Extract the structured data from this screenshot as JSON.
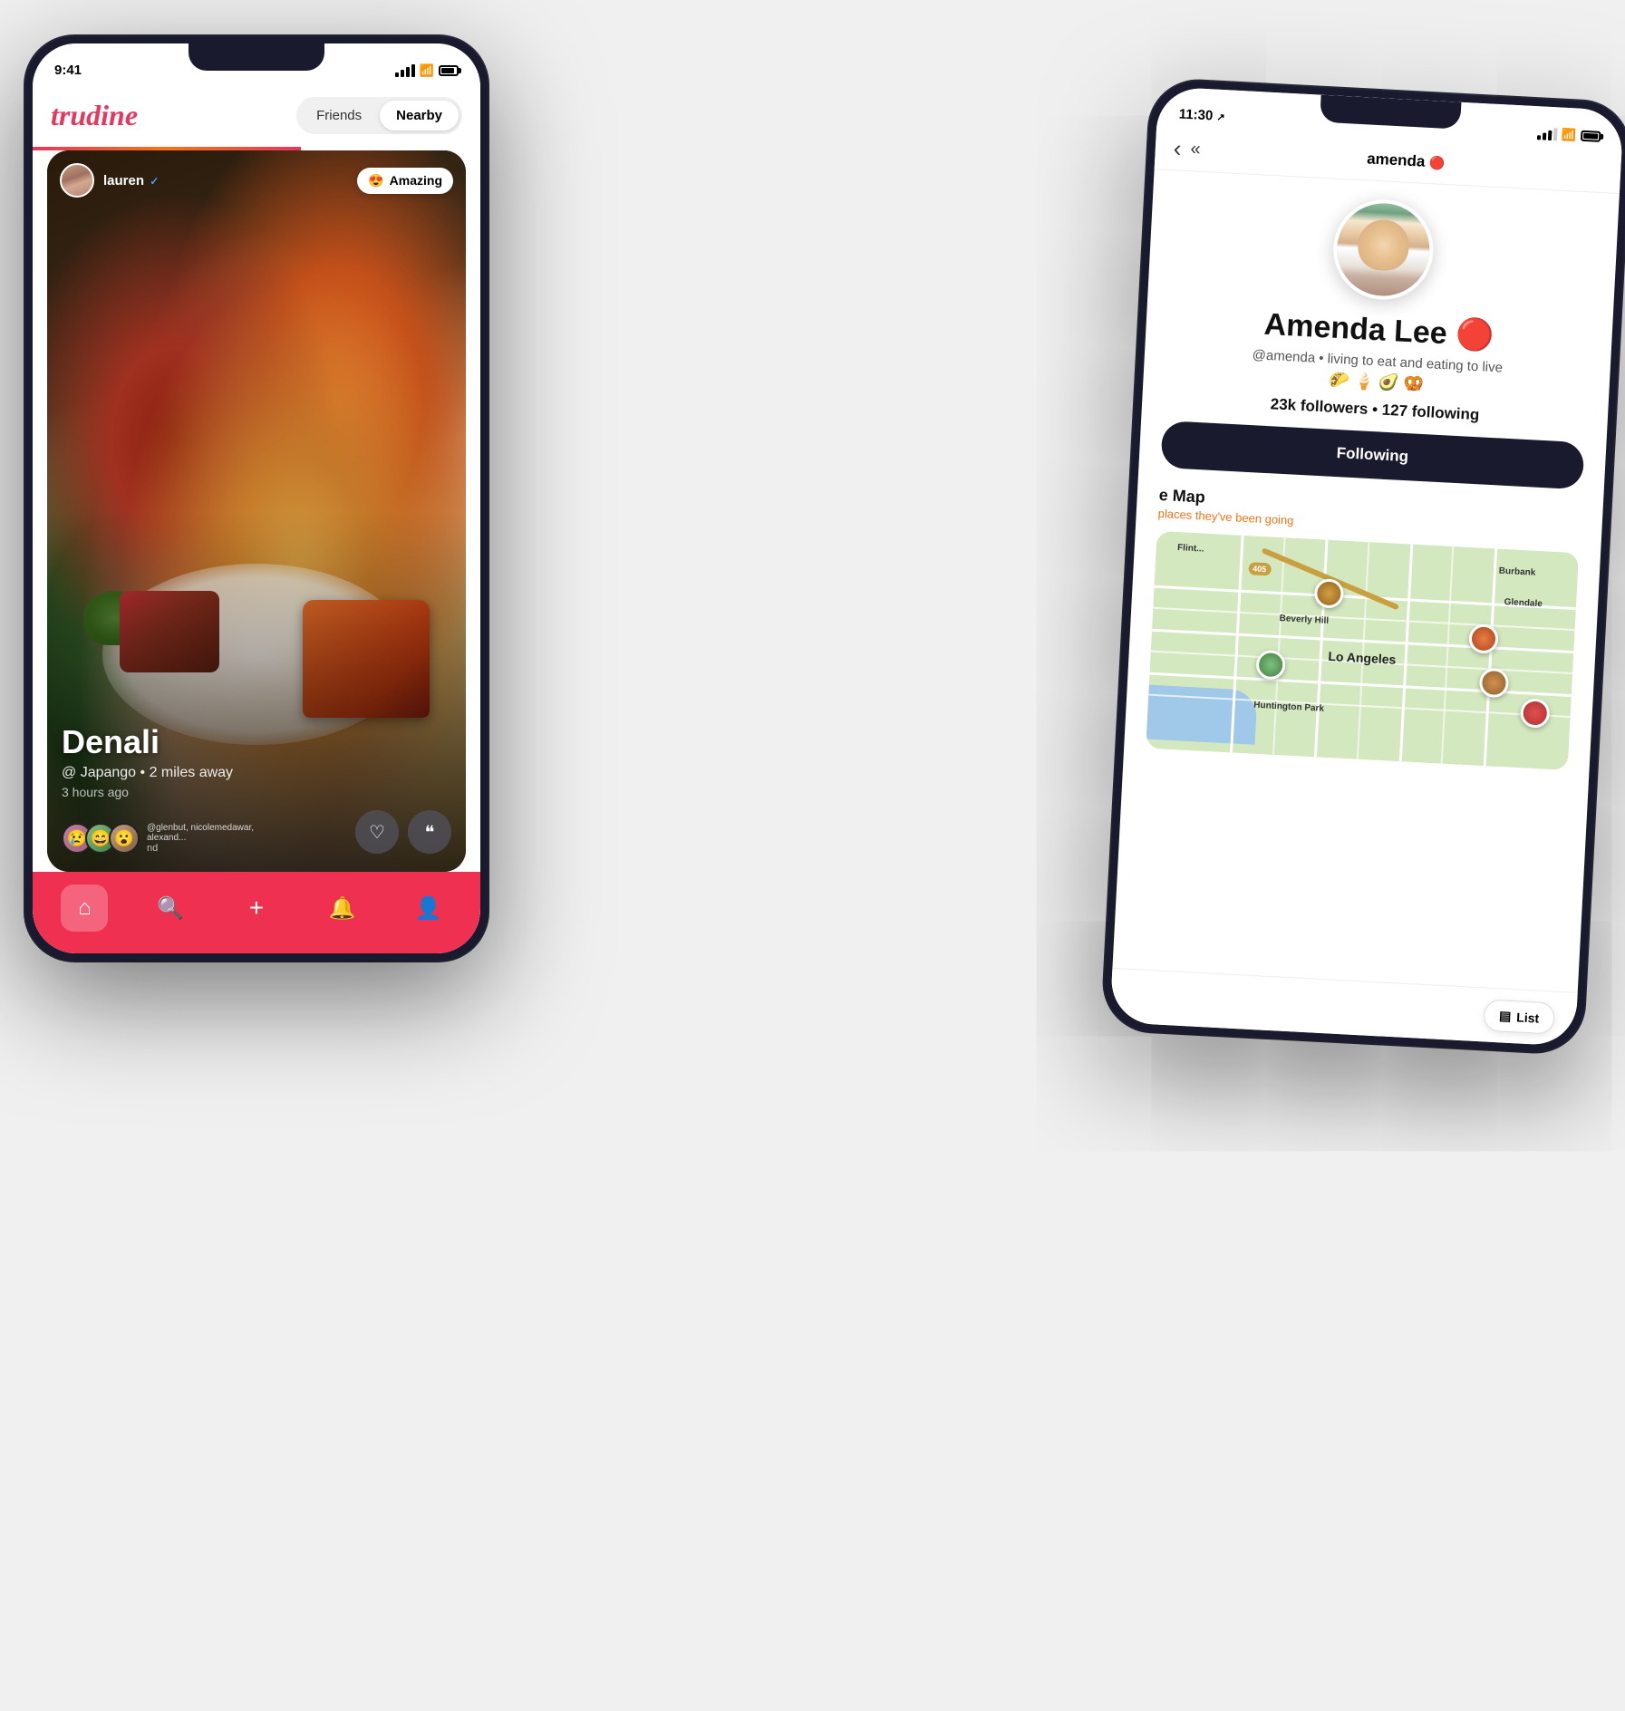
{
  "phone1": {
    "status_bar": {
      "time": "9:41",
      "signal": "●●●",
      "wifi": "WiFi",
      "battery": "Battery"
    },
    "header": {
      "logo": "trudine",
      "tab_friends": "Friends",
      "tab_nearby": "Nearby"
    },
    "feed_card": {
      "username": "lauren",
      "verified": "✓",
      "restaurant": "Denali",
      "location": "@ Japango • 2 miles away",
      "time_ago": "3 hours ago",
      "reaction_label": "Amazing",
      "reaction_emoji": "😍",
      "reactor_names": "@glenbut, nicolemedawar, alexand...",
      "nd_text": "nd"
    },
    "bottom_nav": {
      "home": "⌂",
      "search": "🔍",
      "add": "+",
      "bell": "🔔",
      "profile": "👤"
    }
  },
  "phone2": {
    "status_bar": {
      "time": "11:30",
      "location_icon": "↗"
    },
    "nav": {
      "back_arrow": "‹",
      "back_double": "«",
      "title": "amenda",
      "verified_dot": "🔴"
    },
    "profile": {
      "username_display": "Amenda Lee",
      "handle": "@amenda",
      "bio": "living to eat and eating to live",
      "emojis": "🌮 🍦 🥑 🥨",
      "stats": "23k followers • 127 following",
      "follow_btn": "Following",
      "verified_badge": "🔴"
    },
    "map": {
      "title": "e Map",
      "subtitle": "places they've been going",
      "labels": [
        "Burbank",
        "Glendale",
        "Beverly Hill",
        "Lo Angeles",
        "Huntington Park"
      ],
      "freeway_label": "405",
      "list_btn_icon": "▤",
      "list_btn_label": "List"
    }
  }
}
